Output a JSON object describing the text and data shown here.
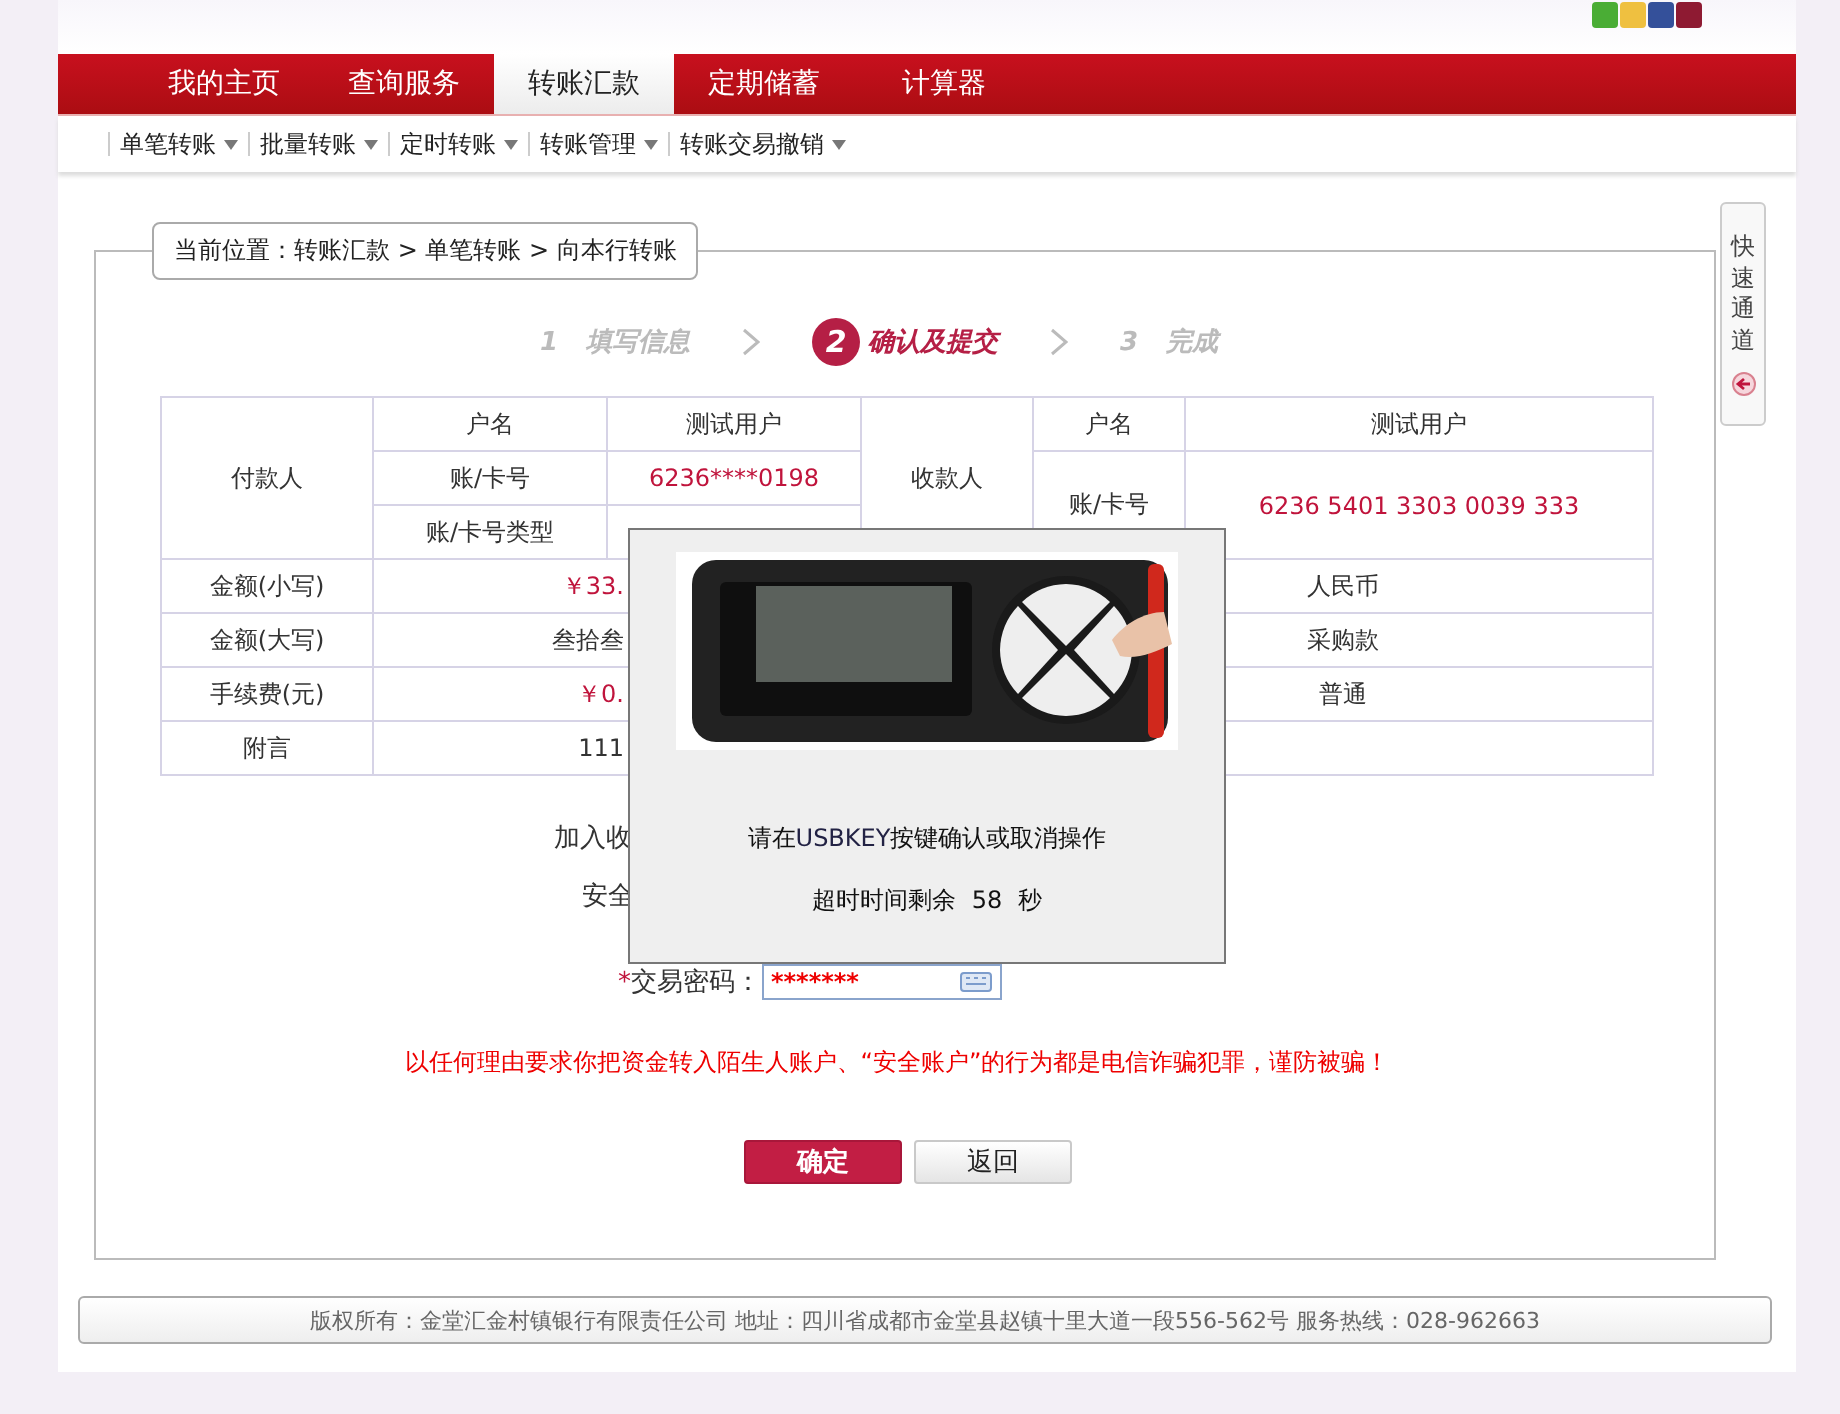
{
  "theme_swatches": [
    {
      "color": "#4aad35"
    },
    {
      "color": "#efc040"
    },
    {
      "color": "#34509a"
    },
    {
      "color": "#8e1a32"
    }
  ],
  "nav": [
    {
      "label": "我的主页",
      "selected": false
    },
    {
      "label": "查询服务",
      "selected": false
    },
    {
      "label": "转账汇款",
      "selected": true
    },
    {
      "label": "定期储蓄",
      "selected": false
    },
    {
      "label": "计算器",
      "selected": false
    }
  ],
  "subnav": [
    {
      "label": "单笔转账"
    },
    {
      "label": "批量转账"
    },
    {
      "label": "定时转账"
    },
    {
      "label": "转账管理"
    },
    {
      "label": "转账交易撤销"
    }
  ],
  "breadcrumb": "当前位置：转账汇款 > 单笔转账 > 向本行转账",
  "steps": [
    {
      "number": "1",
      "label": "填写信息",
      "selected": false
    },
    {
      "number": "2",
      "label": "确认及提交",
      "selected": true
    },
    {
      "number": "3",
      "label": "完成",
      "selected": false
    }
  ],
  "payer": {
    "heading": "付款人",
    "name_label": "户名",
    "name": "测试用户",
    "account_label": "账/卡号",
    "account": "6236****0198",
    "type_label": "账/卡号类型"
  },
  "payee": {
    "heading": "收款人",
    "name_label": "户名",
    "name": "测试用户",
    "account_label": "账/卡号",
    "account": "6236 5401 3303 0039 333"
  },
  "detail_rows": [
    {
      "label": "金额(小写)",
      "value": "￥33.",
      "highlight": true,
      "right_value": "人民币"
    },
    {
      "label": "金额(大写)",
      "value": "叁拾叁",
      "highlight": false,
      "right_value": "采购款"
    },
    {
      "label": "手续费(元)",
      "value": "￥0.",
      "highlight": true,
      "right_value": "普通"
    },
    {
      "label": "附言",
      "value": "111",
      "highlight": false
    }
  ],
  "form": {
    "add_payee_label": "加入收",
    "security_label": "安全",
    "password_label": "交易密码：",
    "required_mark": "*",
    "password_value": "*******"
  },
  "warning": "以任何理由要求你把资金转入陌生人账户、“安全账户”的行为都是电信诈骗犯罪，谨防被骗！",
  "buttons": [
    {
      "label": "确定",
      "kind": "primary"
    },
    {
      "label": "返回",
      "kind": "secondary"
    }
  ],
  "side_tab": "快速通道",
  "footer": "版权所有：金堂汇金村镇银行有限责任公司 地址：四川省成都市金堂县赵镇十里大道一段556-562号 服务热线：028-962663",
  "dialog": {
    "message_before": "请在",
    "message_key": "USBKEY",
    "message_after": "按键确认或取消操作",
    "countdown_label": "超时时间剩余",
    "countdown": "58",
    "countdown_unit": "秒"
  }
}
